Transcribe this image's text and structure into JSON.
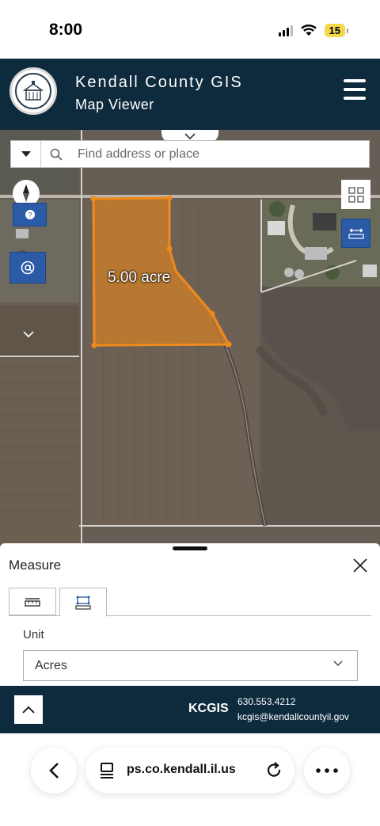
{
  "status_bar": {
    "time": "8:00",
    "battery": "15"
  },
  "header": {
    "title": "Kendall County GIS",
    "subtitle": "Map Viewer"
  },
  "search": {
    "placeholder": "Find address or place"
  },
  "map": {
    "area_label": "5.00 acre",
    "parcel_color": "#f08a1a"
  },
  "measure": {
    "title": "Measure",
    "unit_label": "Unit",
    "unit_value": "Acres",
    "tabs": [
      {
        "name": "distance-tab-icon"
      },
      {
        "name": "area-tab-icon",
        "selected": true
      }
    ]
  },
  "footer": {
    "brand": "KCGIS",
    "phone": "630.553.4212",
    "email": "kcgis@kendallcountyil.gov"
  },
  "browser": {
    "url": "ps.co.kendall.il.us"
  },
  "colors": {
    "header_bg": "#0e2b3e",
    "map_button": "#2b5aa6",
    "accent": "#f08a1a"
  }
}
